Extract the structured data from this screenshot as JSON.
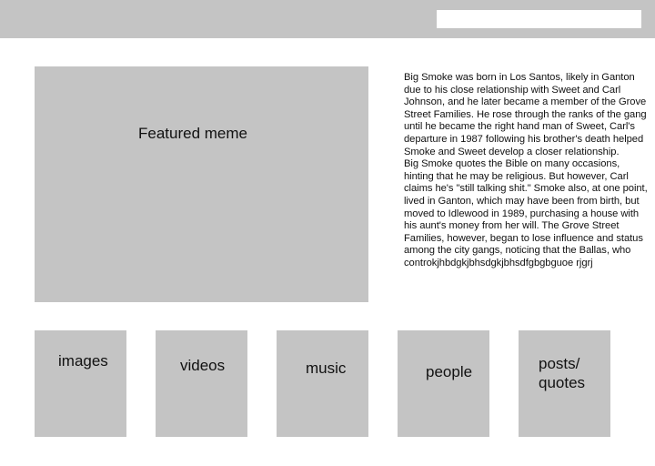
{
  "search": {
    "value": "",
    "placeholder": ""
  },
  "featured": {
    "label": "Featured meme"
  },
  "bio": {
    "paragraphs": [
      "Big Smoke was born in Los Santos, likely in Ganton due to his close relationship with Sweet and Carl Johnson, and he later became a member of the Grove Street Families. He rose through the ranks of the gang until he became the right hand man of Sweet, Carl's departure in 1987 following his brother's death helped Smoke and Sweet develop a closer relationship.",
      "Big Smoke quotes the Bible on many occasions, hinting that he may be religious. But however, Carl claims he's \"still talking shit.\"  Smoke also, at one point, lived in Ganton, which may have been from birth, but moved to Idlewood in 1989, purchasing a house with his aunt's money from her will. The Grove Street Families, however, began to lose influence and status among the city gangs, noticing that the Ballas, who controkjhbdgkjbhsdgkjbhsdfgbgbguoe rjgrj"
    ]
  },
  "categories": [
    {
      "label": "images"
    },
    {
      "label": "videos"
    },
    {
      "label": "music"
    },
    {
      "label": "people"
    },
    {
      "label": "posts/ quotes"
    }
  ],
  "colors": {
    "placeholder_gray": "#c4c4c4",
    "background": "#ffffff",
    "text": "#111111"
  }
}
